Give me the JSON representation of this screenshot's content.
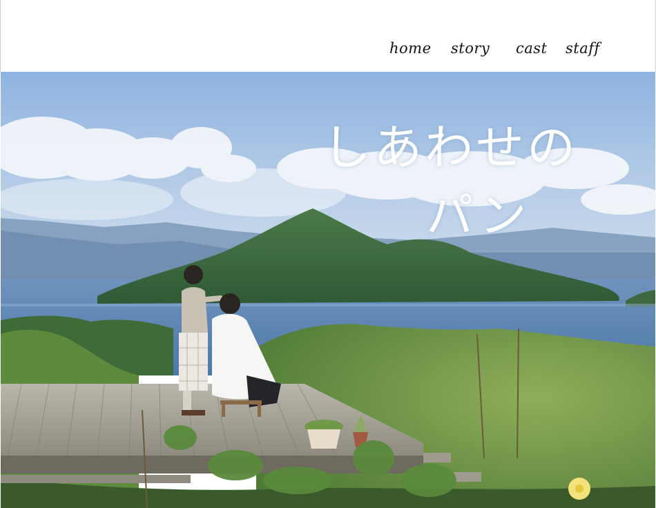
{
  "nav": {
    "home": "home",
    "story": "story",
    "cast": "cast",
    "staff": "staff"
  },
  "hero": {
    "title_line1": "しあわせの",
    "title_line2": "パン"
  }
}
